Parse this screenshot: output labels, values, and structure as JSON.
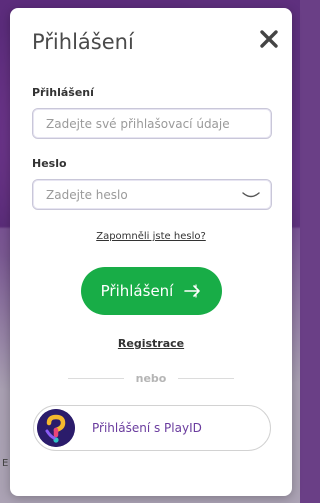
{
  "modal": {
    "title": "Přihlášení",
    "close_icon": "close-icon"
  },
  "login_field": {
    "label": "Přihlášení",
    "placeholder": "Zadejte své přihlašovací údaje",
    "value": ""
  },
  "password_field": {
    "label": "Heslo",
    "placeholder": "Zadejte heslo",
    "value": "",
    "toggle_icon": "eye-closed-icon"
  },
  "forgot_link": "Zapomněli jste heslo?",
  "submit_button": {
    "label": "Přihlášení",
    "icon": "login-arrow-icon",
    "color": "#18ad47"
  },
  "register_link": "Registrace",
  "divider_text": "nebo",
  "playid_button": {
    "label": "Přihlášení s PlayID",
    "icon": "playid-logo-icon"
  },
  "background_fragment": "E"
}
